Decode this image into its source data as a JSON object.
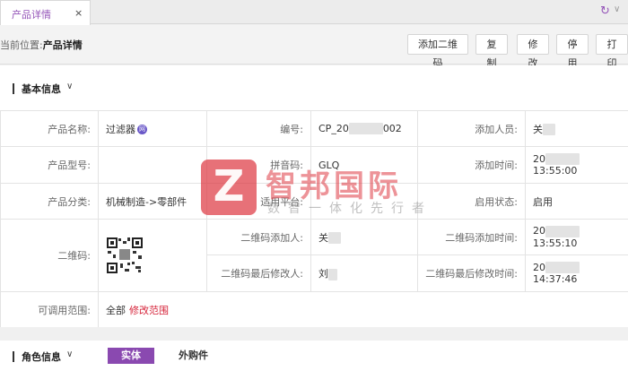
{
  "tab": {
    "label": "产品详情",
    "close": "×"
  },
  "window_controls": {
    "refresh": "↻",
    "more": "∨"
  },
  "breadcrumb": {
    "prefix": "当前位置:",
    "current": "产品详情"
  },
  "toolbar": {
    "add_qrcode": "添加二维码",
    "copy": "复制",
    "edit": "修改",
    "disable": "停用",
    "print": "打印"
  },
  "basic_section": {
    "title": "基本信息",
    "chevron": "∨"
  },
  "fields": {
    "product_name_label": "产品名称:",
    "product_name_value": "过滤器",
    "product_name_badge": "网",
    "code_label": "编号:",
    "code_prefix": "CP_20",
    "code_suffix": "002",
    "added_by_label": "添加人员:",
    "added_by_value": "关",
    "model_label": "产品型号:",
    "model_value": "",
    "pinyin_label": "拼音码:",
    "pinyin_value": "GLQ",
    "added_time_label": "添加时间:",
    "added_time_prefix": "20",
    "added_time_suffix": "13:55:00",
    "category_label": "产品分类:",
    "category_value": "机械制造->零部件",
    "platform_label": "适用平台:",
    "platform_value": "",
    "status_label": "启用状态:",
    "status_value": "启用",
    "qrcode_label": "二维码:",
    "qr_added_by_label": "二维码添加人:",
    "qr_added_by_value": "关",
    "qr_added_time_label": "二维码添加时间:",
    "qr_added_time_prefix": "20",
    "qr_added_time_suffix": "13:55:10",
    "qr_modifier_label": "二维码最后修改人:",
    "qr_modifier_value": "刘",
    "qr_modified_time_label": "二维码最后修改时间:",
    "qr_modified_time_prefix": "20",
    "qr_modified_time_suffix": "14:37:46",
    "scope_label": "可调用范围:",
    "scope_value": "全部",
    "scope_link": "修改范围"
  },
  "role_section": {
    "title": "角色信息",
    "chevron": "∨",
    "tab_active": "实体",
    "tab_other": "外购件"
  },
  "watermark": {
    "logo": "Z",
    "title": "智邦国际",
    "subtitle": "数智一体化先行者"
  },
  "colors": {
    "accent": "#8a49b0",
    "link": "#d6243a",
    "watermark": "#de3a44"
  }
}
